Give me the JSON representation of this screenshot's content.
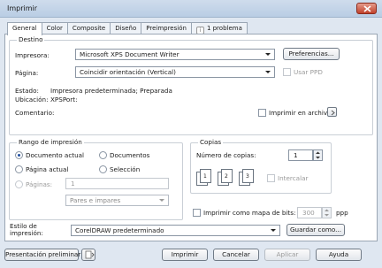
{
  "window": {
    "title": "Imprimir"
  },
  "tabs": [
    {
      "label": "General"
    },
    {
      "label": "Color"
    },
    {
      "label": "Composite"
    },
    {
      "label": "Diseño"
    },
    {
      "label": "Preimpresión"
    },
    {
      "label": "1 problema"
    }
  ],
  "destino": {
    "title": "Destino",
    "impresora_label": "Impresora:",
    "impresora_value": "Microsoft XPS Document Writer",
    "preferencias_label": "Preferencias...",
    "pagina_label": "Página:",
    "pagina_value": "Coincidir orientación (Vertical)",
    "usar_ppd_label": "Usar PPD",
    "estado_label": "Estado:",
    "estado_value": "Impresora predeterminada; Preparada",
    "ubicacion_label": "Ubicación:",
    "ubicacion_value": "XPSPort:",
    "comentario_label": "Comentario:",
    "imprimir_archivo_label": "Imprimir en archivo"
  },
  "rango": {
    "title": "Rango de impresión",
    "documento_actual": "Documento actual",
    "documentos": "Documentos",
    "pagina_actual": "Página actual",
    "seleccion": "Selección",
    "paginas_label": "Páginas:",
    "paginas_value": "1",
    "pares_impares": "Pares e impares"
  },
  "copias": {
    "title": "Copias",
    "numero_label": "Número de copias:",
    "numero_value": "1",
    "intercalar_label": "Intercalar",
    "pages": [
      "1",
      "2",
      "3"
    ],
    "mapa_bits_label": "Imprimir como mapa de bits:",
    "dpi_value": "300",
    "dpi_unit": "ppp"
  },
  "estilo": {
    "label_line1": "Estilo de",
    "label_line2": "impresión:",
    "value": "CorelDRAW predeterminado",
    "guardar_label": "Guardar como..."
  },
  "buttons": {
    "presentacion": "Presentación preliminar",
    "imprimir": "Imprimir",
    "cancelar": "Cancelar",
    "aplicar": "Aplicar",
    "ayuda": "Ayuda"
  }
}
